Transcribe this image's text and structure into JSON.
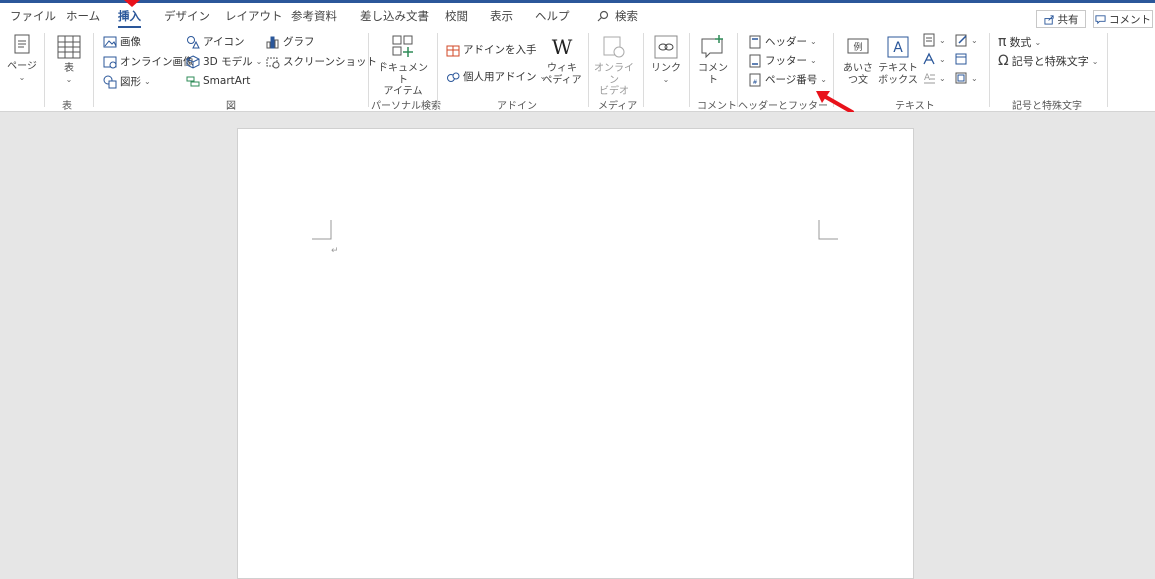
{
  "tabs": {
    "file": "ファイル",
    "home": "ホーム",
    "insert": "挿入",
    "design": "デザイン",
    "layout": "レイアウト",
    "references": "参考資料",
    "mailings": "差し込み文書",
    "review": "校閲",
    "view": "表示",
    "help": "ヘルプ",
    "search": "検索"
  },
  "top_buttons": {
    "share": "共有",
    "comment": "コメント"
  },
  "ribbon": {
    "pages": {
      "label": "ページ",
      "caret": "⌄"
    },
    "table": {
      "label": "表",
      "caret": "⌄",
      "group": "表"
    },
    "illustrations": {
      "picture": "画像",
      "online_picture": "オンライン画像",
      "shapes": "図形",
      "icons": "アイコン",
      "model3d": "3D モデル",
      "smartart": "SmartArt",
      "chart": "グラフ",
      "screenshot": "スクリーンショット",
      "group": "図"
    },
    "document_item": {
      "line1": "ドキュメント",
      "line2": "アイテム",
      "group": "パーソナル検索"
    },
    "addins": {
      "get_addins": "アドインを入手",
      "my_addins": "個人用アドイン",
      "wiki_line1": "ウィキ",
      "wiki_line2": "ペディア",
      "group": "アドイン"
    },
    "media": {
      "line1": "オンライン",
      "line2": "ビデオ",
      "group": "メディア"
    },
    "links": {
      "label": "リンク"
    },
    "comments": {
      "label": "コメント",
      "group": "コメント"
    },
    "header_footer": {
      "header": "ヘッダー",
      "footer": "フッター",
      "page_number": "ページ番号",
      "group": "ヘッダーとフッター"
    },
    "text": {
      "aisatsu_line1": "あいさ",
      "aisatsu_line2": "つ文",
      "textbox_line1": "テキスト",
      "textbox_line2": "ボックス",
      "group": "テキスト"
    },
    "symbols": {
      "equation": "数式",
      "symbol": "記号と特殊文字",
      "group": "記号と特殊文字"
    }
  },
  "document": {
    "paragraph_mark": "↵"
  },
  "colors": {
    "accent": "#2b579a",
    "arrow": "#e8121b"
  }
}
